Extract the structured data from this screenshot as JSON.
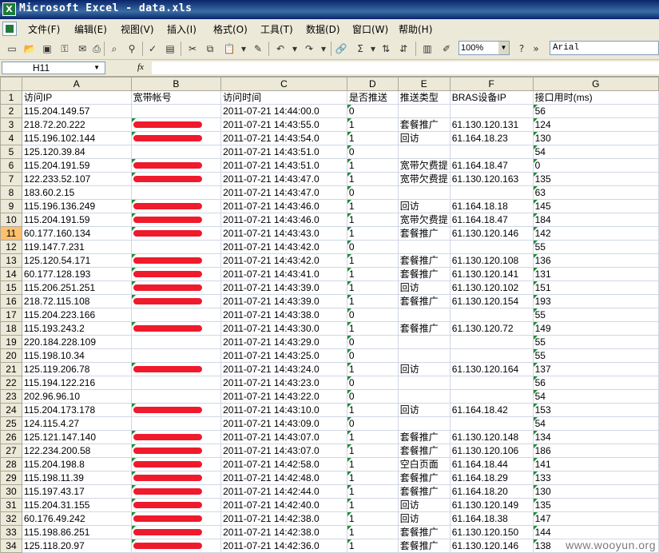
{
  "window": {
    "title": "Microsoft Excel - data.xls",
    "app_icon": "excel-icon"
  },
  "menu": [
    "文件(F)",
    "编辑(E)",
    "视图(V)",
    "插入(I)",
    "格式(O)",
    "工具(T)",
    "数据(D)",
    "窗口(W)",
    "帮助(H)"
  ],
  "toolbar": {
    "zoom": "100%",
    "font": "Arial"
  },
  "formula_bar": {
    "name_box": "H11",
    "fx_label": "fx",
    "formula": ""
  },
  "columns": [
    "A",
    "B",
    "C",
    "D",
    "E",
    "F",
    "G"
  ],
  "selected_cell": {
    "row": "11",
    "col": "H"
  },
  "rows": [
    {
      "n": "1",
      "a": "访问IP",
      "b": "宽带帐号",
      "c": "访问时间",
      "d": "是否推送",
      "e": "推送类型",
      "f": "BRAS设备IP",
      "g": "接口用时(ms)"
    },
    {
      "n": "2",
      "a": "115.204.149.57",
      "b": "",
      "c": "2011-07-21 14:44:00.0",
      "d": "0",
      "e": "",
      "f": "",
      "g": "56"
    },
    {
      "n": "3",
      "a": "218.72.20.222",
      "b": "redacted",
      "c": "2011-07-21 14:43:55.0",
      "d": "1",
      "e": "套餐推广",
      "f": "61.130.120.131",
      "g": "124"
    },
    {
      "n": "4",
      "a": "115.196.102.144",
      "b": "redacted",
      "c": "2011-07-21 14:43:54.0",
      "d": "1",
      "e": "回访",
      "f": "61.164.18.23",
      "g": "130"
    },
    {
      "n": "5",
      "a": "125.120.39.84",
      "b": "",
      "c": "2011-07-21 14:43:51.0",
      "d": "0",
      "e": "",
      "f": "",
      "g": "54"
    },
    {
      "n": "6",
      "a": "115.204.191.59",
      "b": "redacted",
      "c": "2011-07-21 14:43:51.0",
      "d": "1",
      "e": "宽带欠费提",
      "f": "61.164.18.47",
      "g": "0"
    },
    {
      "n": "7",
      "a": "122.233.52.107",
      "b": "redacted",
      "c": "2011-07-21 14:43:47.0",
      "d": "1",
      "e": "宽带欠费提",
      "f": "61.130.120.163",
      "g": "135"
    },
    {
      "n": "8",
      "a": "183.60.2.15",
      "b": "",
      "c": "2011-07-21 14:43:47.0",
      "d": "0",
      "e": "",
      "f": "",
      "g": "63"
    },
    {
      "n": "9",
      "a": "115.196.136.249",
      "b": "redacted",
      "c": "2011-07-21 14:43:46.0",
      "d": "1",
      "e": "回访",
      "f": "61.164.18.18",
      "g": "145"
    },
    {
      "n": "10",
      "a": "115.204.191.59",
      "b": "redacted",
      "c": "2011-07-21 14:43:46.0",
      "d": "1",
      "e": "宽带欠费提",
      "f": "61.164.18.47",
      "g": "184"
    },
    {
      "n": "11",
      "a": "60.177.160.134",
      "b": "redacted",
      "c": "2011-07-21 14:43:43.0",
      "d": "1",
      "e": "套餐推广",
      "f": "61.130.120.146",
      "g": "142"
    },
    {
      "n": "12",
      "a": "119.147.7.231",
      "b": "",
      "c": "2011-07-21 14:43:42.0",
      "d": "0",
      "e": "",
      "f": "",
      "g": "55"
    },
    {
      "n": "13",
      "a": "125.120.54.171",
      "b": "redacted",
      "c": "2011-07-21 14:43:42.0",
      "d": "1",
      "e": "套餐推广",
      "f": "61.130.120.108",
      "g": "136"
    },
    {
      "n": "14",
      "a": "60.177.128.193",
      "b": "redacted",
      "c": "2011-07-21 14:43:41.0",
      "d": "1",
      "e": "套餐推广",
      "f": "61.130.120.141",
      "g": "131"
    },
    {
      "n": "15",
      "a": "115.206.251.251",
      "b": "redacted",
      "c": "2011-07-21 14:43:39.0",
      "d": "1",
      "e": "回访",
      "f": "61.130.120.102",
      "g": "151"
    },
    {
      "n": "16",
      "a": "218.72.115.108",
      "b": "redacted",
      "c": "2011-07-21 14:43:39.0",
      "d": "1",
      "e": "套餐推广",
      "f": "61.130.120.154",
      "g": "193"
    },
    {
      "n": "17",
      "a": "115.204.223.166",
      "b": "",
      "c": "2011-07-21 14:43:38.0",
      "d": "0",
      "e": "",
      "f": "",
      "g": "55"
    },
    {
      "n": "18",
      "a": "115.193.243.2",
      "b": "redacted",
      "c": "2011-07-21 14:43:30.0",
      "d": "1",
      "e": "套餐推广",
      "f": "61.130.120.72",
      "g": "149"
    },
    {
      "n": "19",
      "a": "220.184.228.109",
      "b": "",
      "c": "2011-07-21 14:43:29.0",
      "d": "0",
      "e": "",
      "f": "",
      "g": "55"
    },
    {
      "n": "20",
      "a": "115.198.10.34",
      "b": "",
      "c": "2011-07-21 14:43:25.0",
      "d": "0",
      "e": "",
      "f": "",
      "g": "55"
    },
    {
      "n": "21",
      "a": "125.119.206.78",
      "b": "redacted",
      "c": "2011-07-21 14:43:24.0",
      "d": "1",
      "e": "回访",
      "f": "61.130.120.164",
      "g": "137"
    },
    {
      "n": "22",
      "a": "115.194.122.216",
      "b": "",
      "c": "2011-07-21 14:43:23.0",
      "d": "0",
      "e": "",
      "f": "",
      "g": "56"
    },
    {
      "n": "23",
      "a": "202.96.96.10",
      "b": "",
      "c": "2011-07-21 14:43:22.0",
      "d": "0",
      "e": "",
      "f": "",
      "g": "54"
    },
    {
      "n": "24",
      "a": "115.204.173.178",
      "b": "redacted",
      "c": "2011-07-21 14:43:10.0",
      "d": "1",
      "e": "回访",
      "f": "61.164.18.42",
      "g": "153"
    },
    {
      "n": "25",
      "a": "124.115.4.27",
      "b": "",
      "c": "2011-07-21 14:43:09.0",
      "d": "0",
      "e": "",
      "f": "",
      "g": "54"
    },
    {
      "n": "26",
      "a": "125.121.147.140",
      "b": "redacted",
      "c": "2011-07-21 14:43:07.0",
      "d": "1",
      "e": "套餐推广",
      "f": "61.130.120.148",
      "g": "134"
    },
    {
      "n": "27",
      "a": "122.234.200.58",
      "b": "redacted",
      "c": "2011-07-21 14:43:07.0",
      "d": "1",
      "e": "套餐推广",
      "f": "61.130.120.106",
      "g": "186"
    },
    {
      "n": "28",
      "a": "115.204.198.8",
      "b": "redacted",
      "c": "2011-07-21 14:42:58.0",
      "d": "1",
      "e": "空白页面",
      "f": "61.164.18.44",
      "g": "141"
    },
    {
      "n": "29",
      "a": "115.198.11.39",
      "b": "redacted",
      "c": "2011-07-21 14:42:48.0",
      "d": "1",
      "e": "套餐推广",
      "f": "61.164.18.29",
      "g": "133"
    },
    {
      "n": "30",
      "a": "115.197.43.17",
      "b": "redacted",
      "c": "2011-07-21 14:42:44.0",
      "d": "1",
      "e": "套餐推广",
      "f": "61.164.18.20",
      "g": "130"
    },
    {
      "n": "31",
      "a": "115.204.31.155",
      "b": "redacted",
      "c": "2011-07-21 14:42:40.0",
      "d": "1",
      "e": "回访",
      "f": "61.130.120.149",
      "g": "135"
    },
    {
      "n": "32",
      "a": "60.176.49.242",
      "b": "redacted",
      "c": "2011-07-21 14:42:38.0",
      "d": "1",
      "e": "回访",
      "f": "61.164.18.38",
      "g": "147"
    },
    {
      "n": "33",
      "a": "115.198.86.251",
      "b": "redacted",
      "c": "2011-07-21 14:42:38.0",
      "d": "1",
      "e": "套餐推广",
      "f": "61.130.120.150",
      "g": "144"
    },
    {
      "n": "34",
      "a": "125.118.20.97",
      "b": "redacted",
      "c": "2011-07-21 14:42:36.0",
      "d": "1",
      "e": "套餐推广",
      "f": "61.130.120.146",
      "g": "138"
    }
  ],
  "watermark": "www.wooyun.org",
  "colors": {
    "title_bar": "#0a246a",
    "chrome": "#ece9d8",
    "redaction": "#ef1a2b",
    "selected_header": "#ffc06e"
  }
}
